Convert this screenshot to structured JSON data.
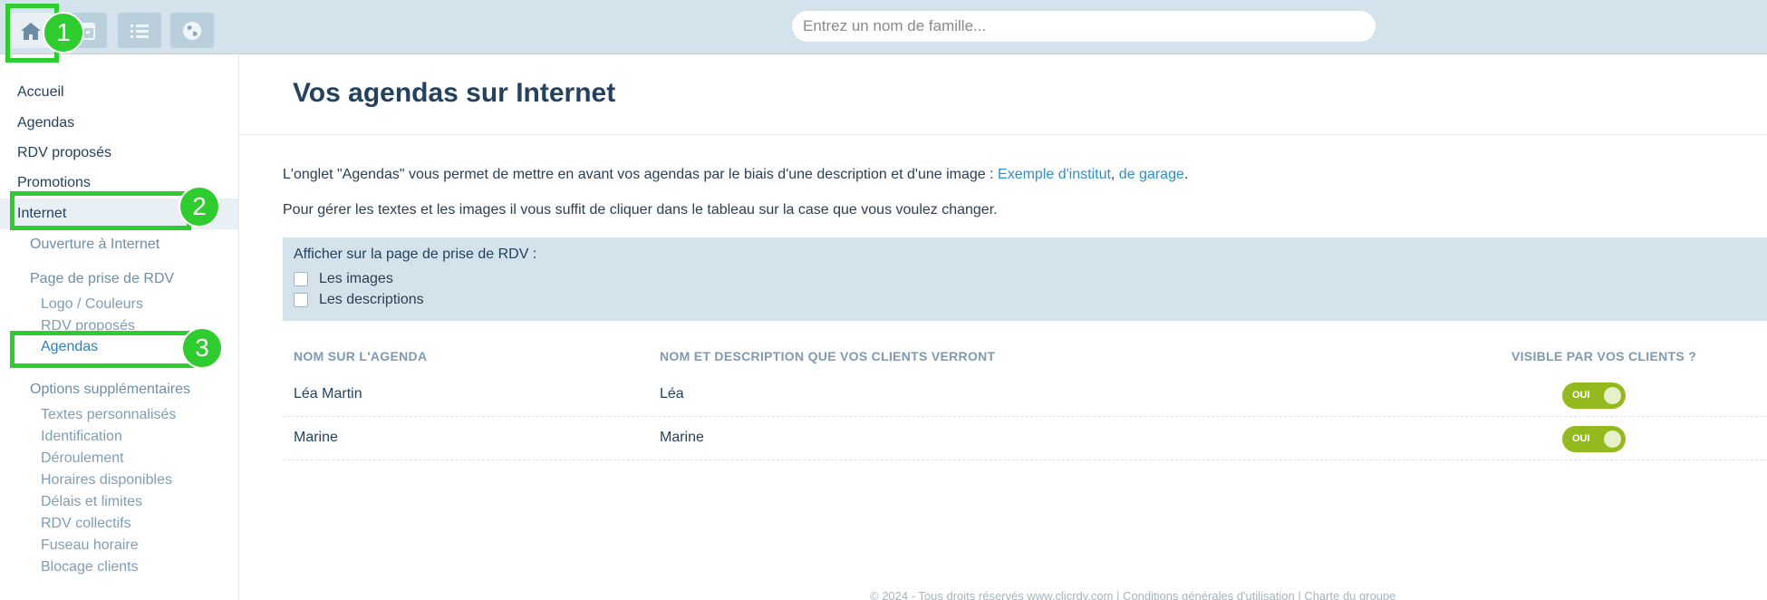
{
  "search": {
    "placeholder": "Entrez un nom de famille..."
  },
  "toolbar": {
    "buttons": [
      {
        "icon": "home-icon"
      },
      {
        "icon": "calendar-icon"
      },
      {
        "icon": "list-icon"
      },
      {
        "icon": "globe-icon"
      }
    ]
  },
  "sidebar": {
    "items": [
      {
        "label": "Accueil"
      },
      {
        "label": "Agendas"
      },
      {
        "label": "RDV proposés"
      },
      {
        "label": "Promotions"
      },
      {
        "label": "Internet"
      }
    ],
    "internet": {
      "ouverture": "Ouverture à Internet",
      "page_prise": "Page de prise de RDV",
      "page_items": [
        "Logo / Couleurs",
        "RDV proposés",
        "Agendas"
      ],
      "options": "Options supplémentaires",
      "option_items": [
        "Textes personnalisés",
        "Identification",
        "Déroulement",
        "Horaires disponibles",
        "Délais et limites",
        "RDV collectifs",
        "Fuseau horaire",
        "Blocage clients"
      ]
    }
  },
  "main": {
    "title": "Vos agendas sur Internet",
    "intro": "L'onglet \"Agendas\" vous permet de mettre en avant vos agendas par le biais d'une description et d'une image : ",
    "link1": "Exemple d'institut",
    "sep": ", ",
    "link2": "de garage",
    "end": ".",
    "help": "Pour gérer les textes et les images il vous suffit de cliquer dans le tableau sur la case que vous voulez changer.",
    "options_title": "Afficher sur la page de prise de RDV :",
    "options": [
      "Les images",
      "Les descriptions"
    ]
  },
  "table": {
    "headers": [
      "NOM SUR L'AGENDA",
      "NOM ET DESCRIPTION QUE VOS CLIENTS VERRONT",
      "VISIBLE PAR VOS CLIENTS ?"
    ],
    "rows": [
      {
        "name": "Léa Martin",
        "display": "Léa",
        "visible": "OUI"
      },
      {
        "name": "Marine",
        "display": "Marine",
        "visible": "OUI"
      }
    ]
  },
  "footer": "© 2024 - Tous droits réservés www.clicrdv.com | Conditions générales d'utilisation | Charte du groupe",
  "annotations": [
    "1",
    "2",
    "3"
  ],
  "colors": {
    "accent": "#2fcc2f",
    "toggle": "#93b91f",
    "topbar": "#d3e2eb"
  }
}
